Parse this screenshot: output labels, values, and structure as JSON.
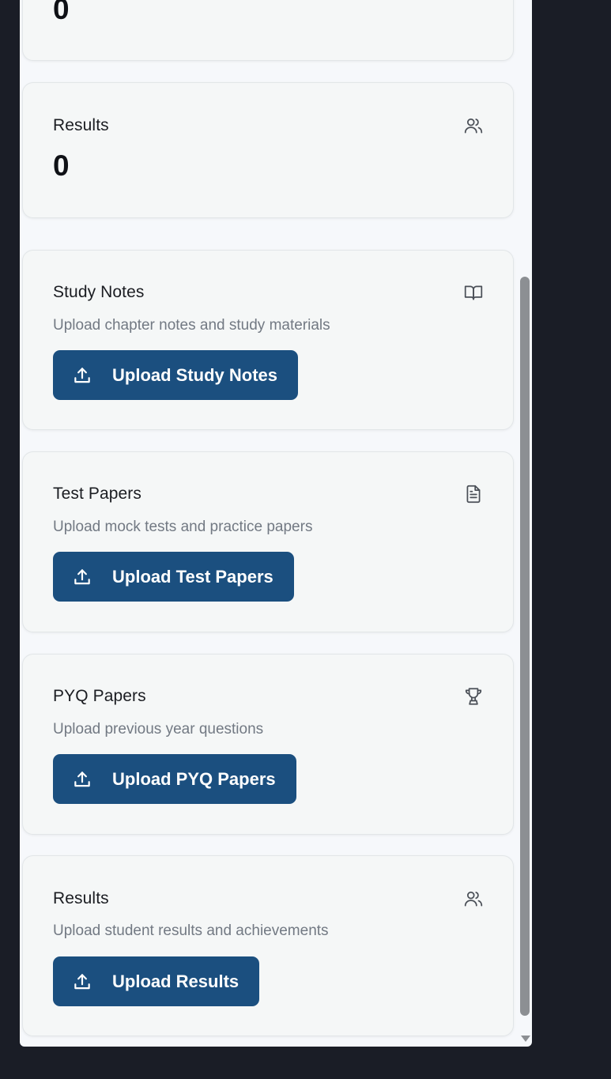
{
  "stats": {
    "partial_count": "0",
    "results": {
      "title": "Results",
      "count": "0",
      "icon": "users-icon"
    }
  },
  "uploads": {
    "study_notes": {
      "title": "Study Notes",
      "description": "Upload chapter notes and study materials",
      "button": "Upload Study Notes",
      "icon": "book-open-icon"
    },
    "test_papers": {
      "title": "Test Papers",
      "description": "Upload mock tests and practice papers",
      "button": "Upload Test Papers",
      "icon": "file-text-icon"
    },
    "pyq_papers": {
      "title": "PYQ Papers",
      "description": "Upload previous year questions",
      "button": "Upload PYQ Papers",
      "icon": "trophy-icon"
    },
    "results": {
      "title": "Results",
      "description": "Upload student results and achievements",
      "button": "Upload Results",
      "icon": "users-icon"
    }
  },
  "colors": {
    "button_bg": "#1b4f7f",
    "page_bg": "#1a1d26",
    "card_bg": "#f5f7f7"
  }
}
